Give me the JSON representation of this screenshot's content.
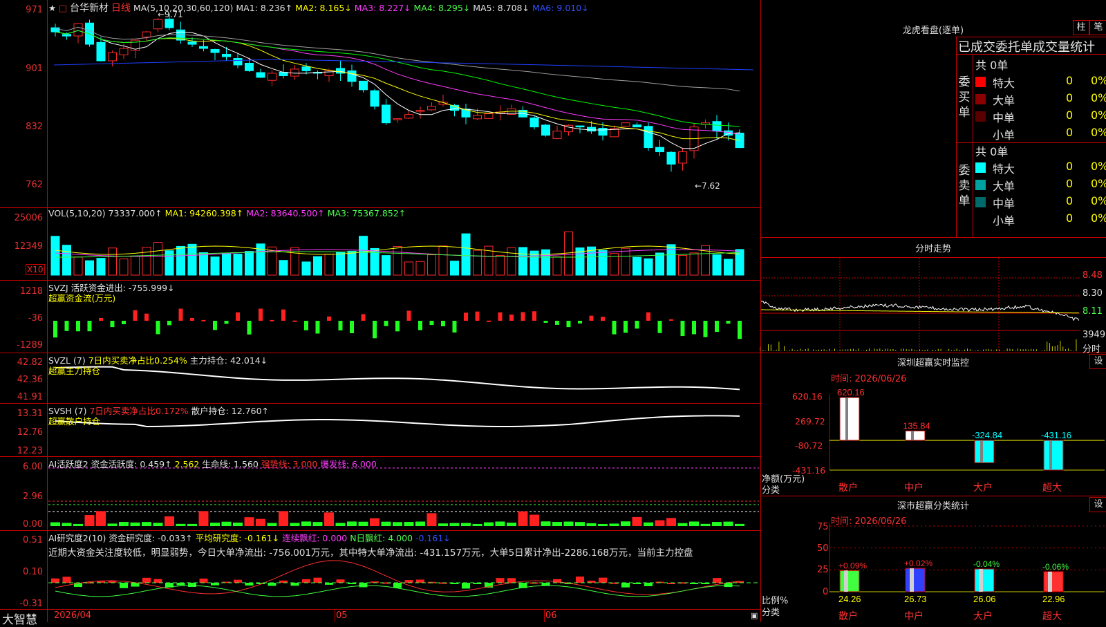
{
  "stock": {
    "title": "台华新材",
    "period": "日线",
    "icons": "★",
    "footer_brand": "大智慧",
    "date_start": "2026/04",
    "month_labels": [
      "05",
      "06"
    ]
  },
  "kline": {
    "ma_header": "MA(5,10,20,30,60,120)",
    "ma1": "MA1: 8.236↑",
    "ma2": "MA2: 8.165↓",
    "ma3": "MA3: 8.227↓",
    "ma4": "MA4: 8.295↓",
    "ma5": "MA5: 8.708↓",
    "ma6": "MA6: 9.010↓",
    "high_mark": "←9.71",
    "low_mark": "←7.62",
    "y_ticks": [
      "971",
      "901",
      "832",
      "762"
    ]
  },
  "volume": {
    "header": "VOL(5,10,20)",
    "value": "73337.000↑",
    "ma1": "MA1: 94260.398↑",
    "ma2": "MA2: 83640.500↑",
    "ma3": "MA3: 75367.852↑",
    "y_ticks": [
      "25006",
      "12349"
    ],
    "unit": "X10"
  },
  "svzj": {
    "header": "SVZJ  活跃资金进出: -755.999↓",
    "sub": "超赢资金流(万元)",
    "y_ticks": [
      "1218",
      "-36",
      "-1289"
    ]
  },
  "svzl": {
    "header_a": "SVZL (7)",
    "header_b": "7日内买卖净占比0.254%",
    "header_c": "主力持仓: 42.014↓",
    "sub": "超赢主力持仓",
    "y_ticks": [
      "42.82",
      "42.36",
      "41.91"
    ]
  },
  "svsh": {
    "header_a": "SVSH (7)",
    "header_b": "7日内买卖净占比0.172%",
    "header_c": "散户持仓: 12.760↑",
    "sub": "超赢散户持仓",
    "y_ticks": [
      "13.31",
      "12.76",
      "12.23"
    ]
  },
  "ai_active": {
    "header_a": "AI活跃度2  资金活跃度: 0.459↑",
    "header_b": "2.562",
    "header_c": "生命线: 1.560",
    "header_d": "强势线: 3.000",
    "header_e": "爆发线: 6.000",
    "y_ticks": [
      "6.00",
      "2.96",
      "0.00"
    ]
  },
  "ai_research": {
    "header_a": "AI研究度2(10)  资金研究度: -0.033↑",
    "header_b": "平均研究度: -0.161↓",
    "header_c": "连续飘红: 0.000",
    "header_d": "N日飘红: 4.000",
    "header_e": "-0.161↓",
    "comment": "近期大资金关注度较低，明显弱势，今日大单净流出: -756.001万元，其中特大单净流出: -431.157万元，大单5日累计净出-2286.168万元，当前主力控盘",
    "y_ticks": [
      "0.51",
      "0.10",
      "-0.31"
    ]
  },
  "dragon": {
    "title": "龙虎看盘(逐单)",
    "btn1": "柱",
    "btn2": "笔",
    "subtitle": "已成交委托单成交量统计",
    "buy_label": "委买单",
    "sell_label": "委卖单",
    "buy_total": "共 0单",
    "sell_total": "共 0单",
    "buy_rows": [
      {
        "name": "特大",
        "count": "0",
        "pct": "0%",
        "color": "#ff0000"
      },
      {
        "name": "大单",
        "count": "0",
        "pct": "0%",
        "color": "#8b0000"
      },
      {
        "name": "中单",
        "count": "0",
        "pct": "0%",
        "color": "#5a0000"
      },
      {
        "name": "小单",
        "count": "0",
        "pct": "0%",
        "color": "#000000"
      }
    ],
    "sell_rows": [
      {
        "name": "特大",
        "count": "0",
        "pct": "0%",
        "color": "#00ffff"
      },
      {
        "name": "大单",
        "count": "0",
        "pct": "0%",
        "color": "#00a0a0"
      },
      {
        "name": "中单",
        "count": "0",
        "pct": "0%",
        "color": "#006a6a"
      },
      {
        "name": "小单",
        "count": "0",
        "pct": "0%",
        "color": "#000000"
      }
    ]
  },
  "intraday": {
    "title": "分时走势",
    "price_ticks": [
      "8.48",
      "8.30",
      "8.11"
    ],
    "vol_tick": "3949",
    "vol_label": "分时"
  },
  "monitor": {
    "title": "深圳超赢实时监控",
    "btn": "设",
    "time": "时间: 2026/06/26",
    "y_ticks": [
      "620.16",
      "269.72",
      "-80.72",
      "-431.16"
    ],
    "ylabel": "净额(万元)",
    "xlabel": "分类",
    "categories": [
      "散户",
      "中户",
      "大户",
      "超大"
    ],
    "value_labels": [
      "620.16",
      "135.84",
      "-324.84",
      "-431.16"
    ]
  },
  "classify": {
    "title": "深市超赢分类统计",
    "btn": "设",
    "time": "时间: 2026/06/26",
    "y_ticks": [
      "75",
      "50",
      "25",
      "0"
    ],
    "ylabel": "比例%",
    "xlabel": "分类",
    "categories": [
      "散户",
      "中户",
      "大户",
      "超大"
    ],
    "top_labels": [
      "+0.09%",
      "+0.02%",
      "-0.04%",
      "-0.06%"
    ],
    "bottom_labels": [
      "24.26",
      "26.73",
      "26.06",
      "22.96"
    ]
  },
  "chart_data": [
    {
      "type": "bar",
      "title": "深圳超赢实时监控",
      "categories": [
        "散户",
        "中户",
        "大户",
        "超大"
      ],
      "values": [
        620.16,
        135.84,
        -324.84,
        -431.16
      ],
      "ylabel": "净额(万元)",
      "xlabel": "分类",
      "ylim": [
        -431.16,
        620.16
      ],
      "colors": [
        "#ffffff",
        "#ffffff",
        "#00ffff",
        "#00ffff"
      ]
    },
    {
      "type": "bar",
      "title": "深市超赢分类统计",
      "categories": [
        "散户",
        "中户",
        "大户",
        "超大"
      ],
      "values": [
        24.26,
        26.73,
        26.06,
        22.96
      ],
      "changes": [
        "+0.09%",
        "+0.02%",
        "-0.04%",
        "-0.06%"
      ],
      "ylabel": "比例%",
      "xlabel": "分类",
      "ylim": [
        0,
        75
      ],
      "colors": [
        "#40ff40",
        "#3040ff",
        "#00ffff",
        "#ff3030"
      ]
    },
    {
      "type": "line",
      "title": "台华新材 日线",
      "y_ticks": [
        9.71,
        9.01,
        8.32,
        7.62
      ],
      "high": 9.71,
      "low": 7.62,
      "last_close_approx": 8.05
    }
  ],
  "colors": {
    "up": "#ff2a2a",
    "down": "#00ffff",
    "grid": "#c80000",
    "ma1": "#ffffff",
    "ma2": "#ffff00",
    "ma3": "#ff3cff",
    "ma4": "#00ff00",
    "ma5": "#a0a0a0",
    "ma6": "#2040ff"
  }
}
